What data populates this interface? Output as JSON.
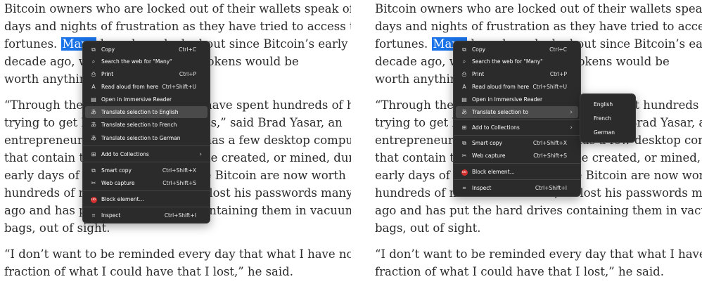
{
  "article": {
    "lines_p1": [
      "Bitcoin owners who are locked out of their wallets speak of endless",
      "days and nights of frustration as they have tried to access their",
      "",
      "decade ago, who believe that the tokens would be",
      "worth anything."
    ],
    "selected_word": "Many",
    "p1_line3_before": "fortunes. ",
    "p1_line3_after": " have been locked out since Bitcoin’s early days a",
    "lines_p2": [
      "“Through the years, I would say I have spent hundreds of hours",
      "trying to get back into these wallets,” said Brad Yasar, an",
      "entrepreneur in Los Angeles who has a few desktop computers",
      "that contain thousands of Bitcoin he created, or mined, during the",
      "early days of the technology. Those Bitcoin are now worth",
      "hundreds of millions of dollars, he lost his passwords many years",
      "ago and has put the hard drives containing them in vacuum-sealed",
      "bags, out of sight."
    ],
    "lines_p3": [
      "“I don’t want to be reminded every day that what I have now is a",
      "fraction of what I could have that I lost,” he said."
    ]
  },
  "left_menu": {
    "items": [
      {
        "icon": "copy-icon",
        "glyph": "⧉",
        "label": "Copy",
        "shortcut": "Ctrl+C"
      },
      {
        "icon": "search-icon",
        "glyph": "⌕",
        "label": "Search the web for \"Many\"",
        "shortcut": ""
      },
      {
        "icon": "print-icon",
        "glyph": "⎙",
        "label": "Print",
        "shortcut": "Ctrl+P"
      },
      {
        "icon": "read-aloud-icon",
        "glyph": "A",
        "label": "Read aloud from here",
        "shortcut": "Ctrl+Shift+U"
      },
      {
        "icon": "immersive-reader-icon",
        "glyph": "▤",
        "label": "Open in Immersive Reader",
        "shortcut": ""
      },
      {
        "icon": "translate-icon",
        "glyph": "あ",
        "label": "Translate selection to English",
        "shortcut": ""
      },
      {
        "icon": "translate-icon",
        "glyph": "あ",
        "label": "Translate selection to French",
        "shortcut": ""
      },
      {
        "icon": "translate-icon",
        "glyph": "あ",
        "label": "Translate selection to German",
        "shortcut": ""
      },
      {
        "icon": "collections-icon",
        "glyph": "⊞",
        "label": "Add to Collections",
        "shortcut": ""
      },
      {
        "icon": "smart-copy-icon",
        "glyph": "⧉",
        "label": "Smart copy",
        "shortcut": "Ctrl+Shift+X"
      },
      {
        "icon": "web-capture-icon",
        "glyph": "✂",
        "label": "Web capture",
        "shortcut": "Ctrl+Shift+S"
      },
      {
        "icon": "block-element-icon",
        "glyph": "uo",
        "label": "Block element...",
        "shortcut": ""
      },
      {
        "icon": "inspect-icon",
        "glyph": "⌗",
        "label": "Inspect",
        "shortcut": "Ctrl+Shift+I"
      }
    ]
  },
  "right_menu": {
    "items": [
      {
        "icon": "copy-icon",
        "glyph": "⧉",
        "label": "Copy",
        "shortcut": "Ctrl+C"
      },
      {
        "icon": "search-icon",
        "glyph": "⌕",
        "label": "Search the web for \"Many\"",
        "shortcut": ""
      },
      {
        "icon": "print-icon",
        "glyph": "⎙",
        "label": "Print",
        "shortcut": "Ctrl+P"
      },
      {
        "icon": "read-aloud-icon",
        "glyph": "A",
        "label": "Read aloud from here",
        "shortcut": "Ctrl+Shift+U"
      },
      {
        "icon": "immersive-reader-icon",
        "glyph": "▤",
        "label": "Open in Immersive Reader",
        "shortcut": ""
      },
      {
        "icon": "translate-icon",
        "glyph": "あ",
        "label": "Translate selection to",
        "shortcut": ""
      },
      {
        "icon": "collections-icon",
        "glyph": "⊞",
        "label": "Add to Collections",
        "shortcut": ""
      },
      {
        "icon": "smart-copy-icon",
        "glyph": "⧉",
        "label": "Smart copy",
        "shortcut": "Ctrl+Shift+X"
      },
      {
        "icon": "web-capture-icon",
        "glyph": "✂",
        "label": "Web capture",
        "shortcut": "Ctrl+Shift+S"
      },
      {
        "icon": "block-element-icon",
        "glyph": "uo",
        "label": "Block element...",
        "shortcut": ""
      },
      {
        "icon": "inspect-icon",
        "glyph": "⌗",
        "label": "Inspect",
        "shortcut": "Ctrl+Shift+I"
      }
    ],
    "submenu": [
      "English",
      "French",
      "German"
    ]
  },
  "colors": {
    "selection": "#1a73e8",
    "menu_bg": "#2b2b2b",
    "menu_active": "#4a4a4a",
    "block_red": "#d32f2f"
  }
}
